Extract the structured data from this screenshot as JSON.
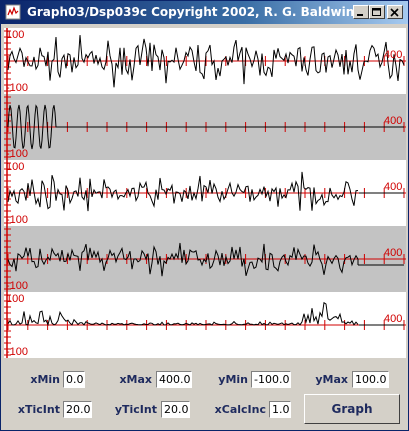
{
  "window": {
    "title": "Graph03/Dsp039c Copyright 2002, R. G. Baldwin",
    "minimize_icon": "minimize-icon",
    "maximize_icon": "maximize-icon",
    "close_icon": "close-icon"
  },
  "plots": [
    {
      "name": "plot-1",
      "label_top": "100",
      "label_bottom": "-100",
      "label_right": "400",
      "shaded": false
    },
    {
      "name": "plot-2",
      "label_top": "",
      "label_bottom": "-100",
      "label_right": "400",
      "shaded": true
    },
    {
      "name": "plot-3",
      "label_top": "100",
      "label_bottom": "-100",
      "label_right": "400",
      "shaded": false
    },
    {
      "name": "plot-4",
      "label_top": "",
      "label_bottom": "-100",
      "label_right": "400",
      "shaded": true
    },
    {
      "name": "plot-5",
      "label_top": "100",
      "label_bottom": "-100",
      "label_right": "400",
      "shaded": false
    }
  ],
  "controls": {
    "xMin_label": "xMin",
    "xMin_value": "0.0",
    "xMax_label": "xMax",
    "xMax_value": "400.0",
    "yMin_label": "yMin",
    "yMin_value": "-100.0",
    "yMax_label": "yMax",
    "yMax_value": "100.0",
    "xTicInt_label": "xTicInt",
    "xTicInt_value": "20.0",
    "yTicInt_label": "yTicInt",
    "yTicInt_value": "20.0",
    "xCalcInc_label": "xCalcInc",
    "xCalcInc_value": "1.0",
    "graph_label": "Graph"
  },
  "colors": {
    "axis": "#d00000",
    "trace": "#000000",
    "shaded_band": "#c3c3c3"
  }
}
